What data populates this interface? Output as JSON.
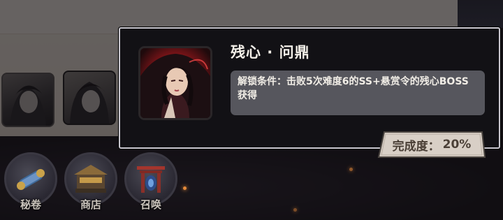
{
  "popup": {
    "title": "残心 · 问鼎",
    "description": "解锁条件：击败5次难度6的SS+悬赏令的残心BOSS获得",
    "progress_label": "完成度：",
    "progress_value": "20%"
  },
  "nav": {
    "items": [
      {
        "label": "秘卷",
        "icon": "scroll-icon"
      },
      {
        "label": "商店",
        "icon": "shop-icon"
      },
      {
        "label": "召唤",
        "icon": "summon-gate-icon"
      }
    ]
  },
  "colors": {
    "popup_bg": "#121115",
    "desc_bg": "#56565d",
    "badge_bg": "#d8cfc6",
    "accent_red": "#b3222f"
  }
}
